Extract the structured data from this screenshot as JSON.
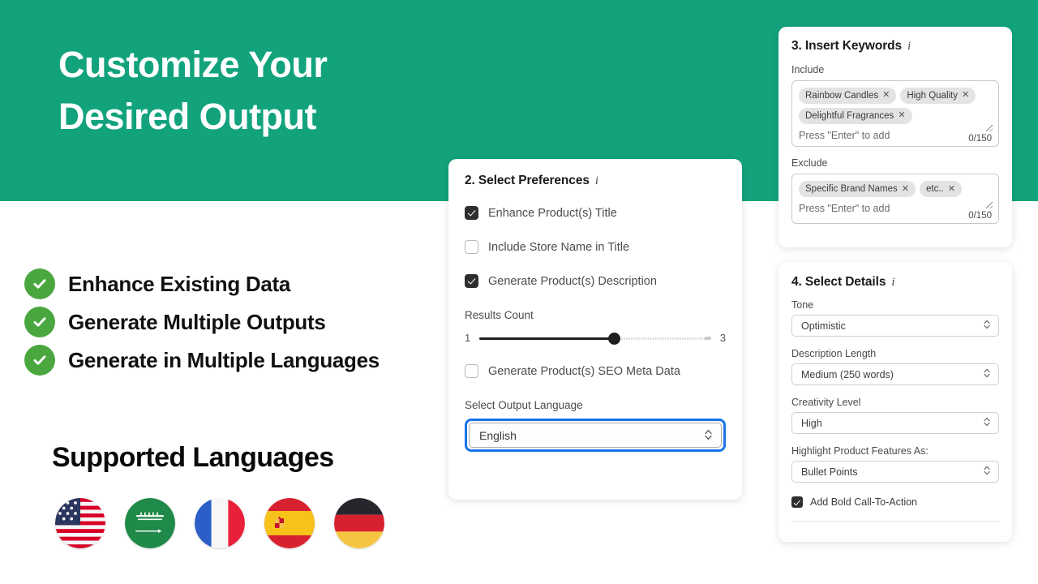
{
  "colors": {
    "teal_band": "#12a37d",
    "check_green": "#4aa73f",
    "focus_blue": "#1a73e8",
    "checkbox_on": "#2e2e2e"
  },
  "hero": {
    "line1": "Customize Your",
    "line2": "Desired Output"
  },
  "features": [
    {
      "label": "Enhance  Existing Data",
      "icon": "check-circle-icon"
    },
    {
      "label": "Generate Multiple Outputs",
      "icon": "check-circle-icon"
    },
    {
      "label": "Generate in Multiple Languages",
      "icon": "check-circle-icon"
    }
  ],
  "supported_languages": {
    "title": "Supported Languages",
    "flags": [
      {
        "name": "flag-usa"
      },
      {
        "name": "flag-saudi-arabia"
      },
      {
        "name": "flag-france"
      },
      {
        "name": "flag-spain"
      },
      {
        "name": "flag-germany"
      }
    ]
  },
  "preferences_card": {
    "title": "2. Select Preferences",
    "info_icon": "i",
    "checkboxes": [
      {
        "label": "Enhance Product(s) Title",
        "checked": true
      },
      {
        "label": "Include Store Name in Title",
        "checked": false
      },
      {
        "label": "Generate Product(s) Description",
        "checked": true
      }
    ],
    "results_count": {
      "label": "Results Count",
      "min": "1",
      "max": "3",
      "value": 2,
      "fill_percent": "58%"
    },
    "seo_checkbox": {
      "label": "Generate Product(s) SEO Meta Data",
      "checked": false
    },
    "output_language": {
      "label": "Select Output Language",
      "value": "English",
      "stepper_glyph": "⌃⌄"
    }
  },
  "keywords_card": {
    "title": "3. Insert Keywords",
    "info_icon": "i",
    "include": {
      "label": "Include",
      "tags": [
        "Rainbow Candles",
        "High Quality",
        "Delightful Fragrances"
      ],
      "placeholder": "Press \"Enter\" to add",
      "counter": "0/150"
    },
    "exclude": {
      "label": "Exclude",
      "tags": [
        "Specific Brand Names",
        "etc.."
      ],
      "placeholder": "Press \"Enter\" to add",
      "counter": "0/150"
    },
    "tag_remove_glyph": "✕"
  },
  "details_card": {
    "title": "4. Select Details",
    "info_icon": "i",
    "fields": [
      {
        "label": "Tone",
        "value": "Optimistic"
      },
      {
        "label": "Description Length",
        "value": "Medium (250 words)"
      },
      {
        "label": "Creativity Level",
        "value": "High"
      },
      {
        "label": "Highlight Product Features As:",
        "value": "Bullet Points"
      }
    ],
    "cta_checkbox": {
      "label": "Add Bold Call-To-Action",
      "checked": true
    },
    "stepper_glyph": "⌃⌄"
  }
}
